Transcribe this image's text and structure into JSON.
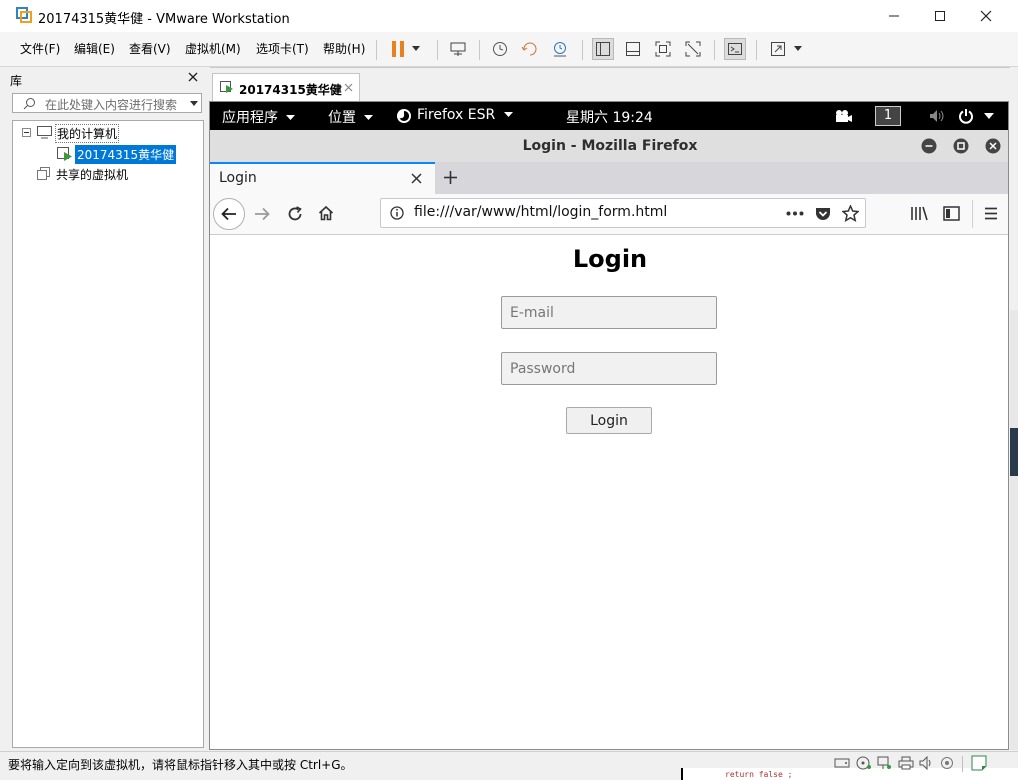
{
  "window": {
    "title": "20174315黄华健 - VMware Workstation"
  },
  "menu": {
    "items": [
      "文件(F)",
      "编辑(E)",
      "查看(V)",
      "虚拟机(M)",
      "选项卡(T)",
      "帮助(H)"
    ]
  },
  "library": {
    "title": "库",
    "search_placeholder": "在此处键入内容进行搜索",
    "tree": {
      "root": "我的计算机",
      "vm": "20174315黄华健",
      "shared": "共享的虚拟机"
    }
  },
  "vm_tab": {
    "label": "20174315黄华健"
  },
  "guest": {
    "topbar": {
      "apps": "应用程序",
      "places": "位置",
      "firefox": "Firefox ESR",
      "clock": "星期六 19:24",
      "workspace": "1"
    },
    "firefox": {
      "window_title": "Login - Mozilla Firefox",
      "tab_label": "Login",
      "url": "file:///var/www/html/login_form.html",
      "page": {
        "heading": "Login",
        "email_placeholder": "E-mail",
        "password_placeholder": "Password",
        "button": "Login"
      }
    }
  },
  "statusbar": {
    "text": "要将输入定向到该虚拟机，请将鼠标指针移入其中或按 Ctrl+G。"
  },
  "background_snippet": "return false ;",
  "colors": {
    "selection": "#0078d7",
    "pause_orange": "#e8821e"
  }
}
